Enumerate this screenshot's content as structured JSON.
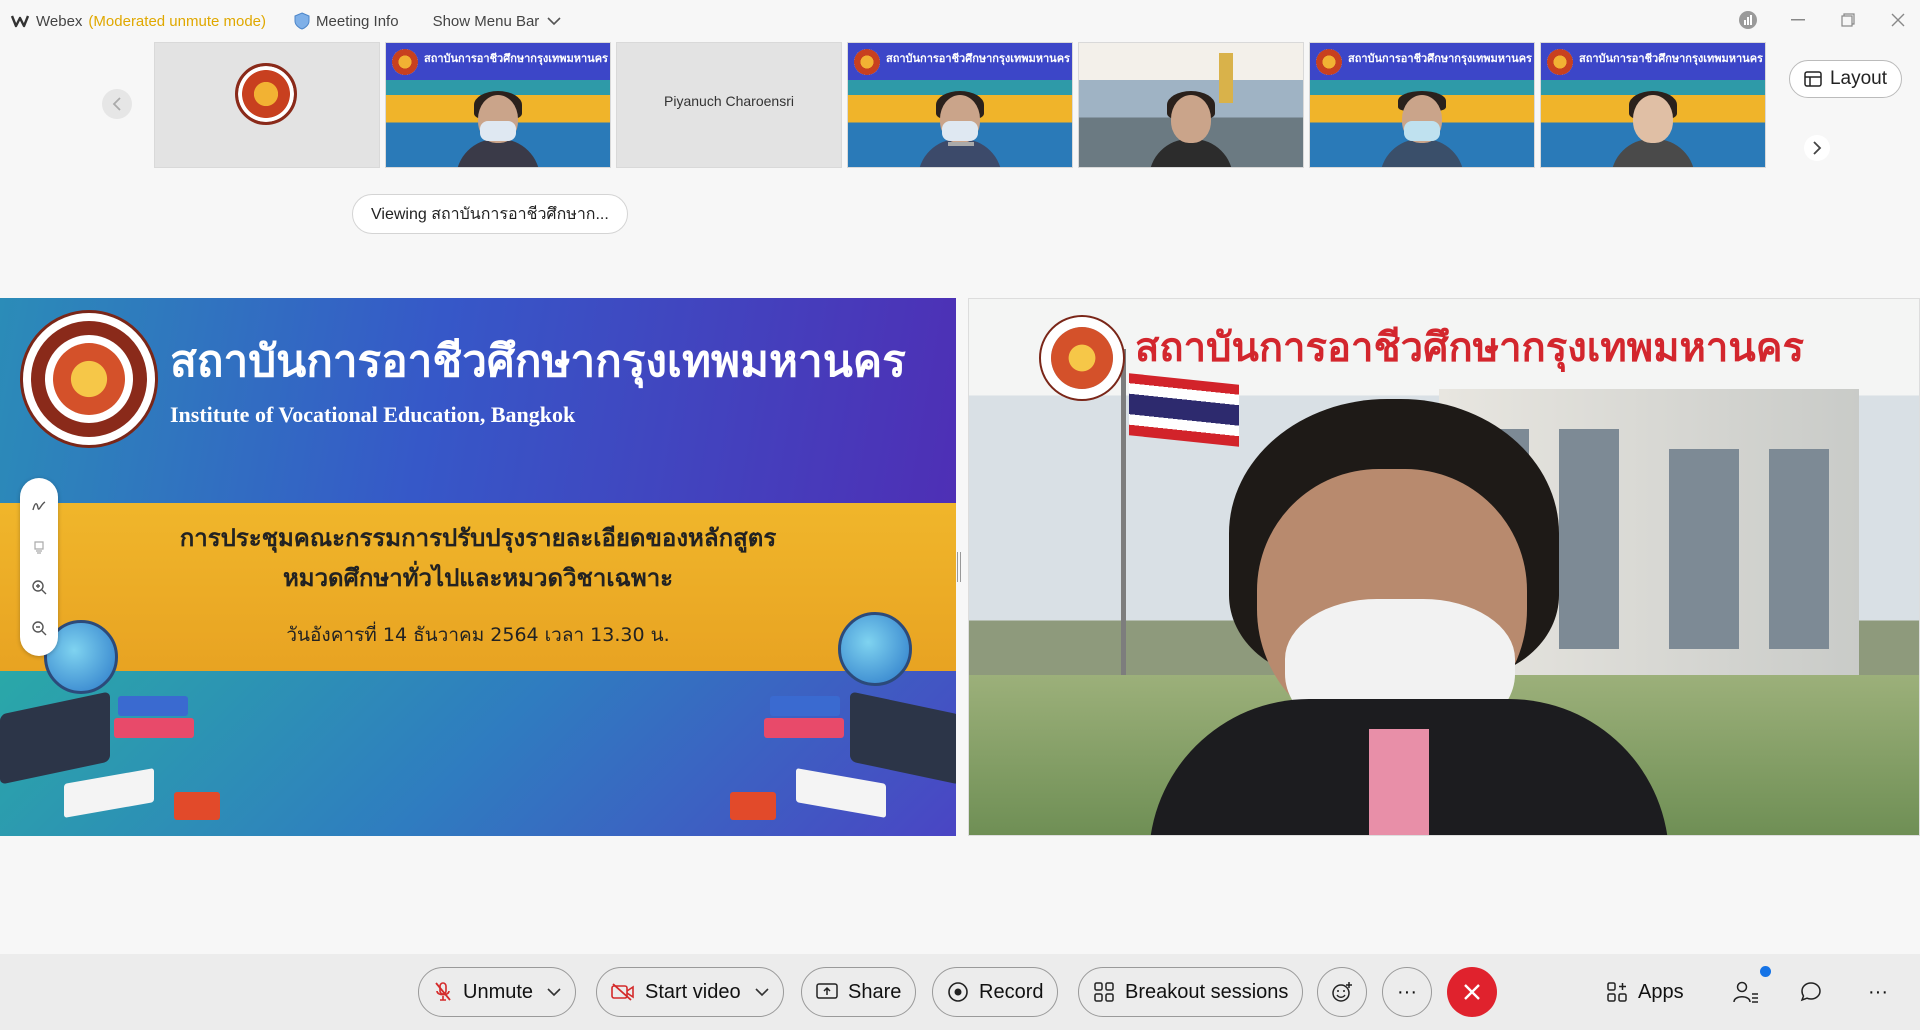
{
  "titlebar": {
    "app_name": "Webex",
    "mode": "(Moderated unmute mode)",
    "meeting_info": "Meeting Info",
    "show_menu_bar": "Show Menu Bar"
  },
  "thumbnails": {
    "participant_name": "Piyanuch Charoensri",
    "slide_title": "สถาบันการอาชีวศึกษากรุงเทพมหานคร"
  },
  "layout_button": "Layout",
  "viewing": "Viewing สถาบันการอาชีวศึกษาก...",
  "slide": {
    "title_th": "สถาบันการอาชีวศึกษากรุงเทพมหานคร",
    "title_en": "Institute of Vocational Education, Bangkok",
    "line1": "การประชุมคณะกรรมการปรับปรุงรายละเอียดของหลักสูตร",
    "line2": "หมวดศึกษาทั่วไปและหมวดวิชาเฉพาะ",
    "line3": "วันอังคารที่ 14 ธันวาคม 2564 เวลา 13.30 น."
  },
  "video": {
    "background_title": "สถาบันการอาชีวศึกษากรุงเทพมหานคร"
  },
  "controls": {
    "unmute": "Unmute",
    "start_video": "Start video",
    "share": "Share",
    "record": "Record",
    "breakout": "Breakout sessions",
    "apps": "Apps",
    "more": "···"
  },
  "colors": {
    "accent_mode": "#e0a800",
    "end_call": "#e0222d",
    "notification": "#1573e6"
  }
}
